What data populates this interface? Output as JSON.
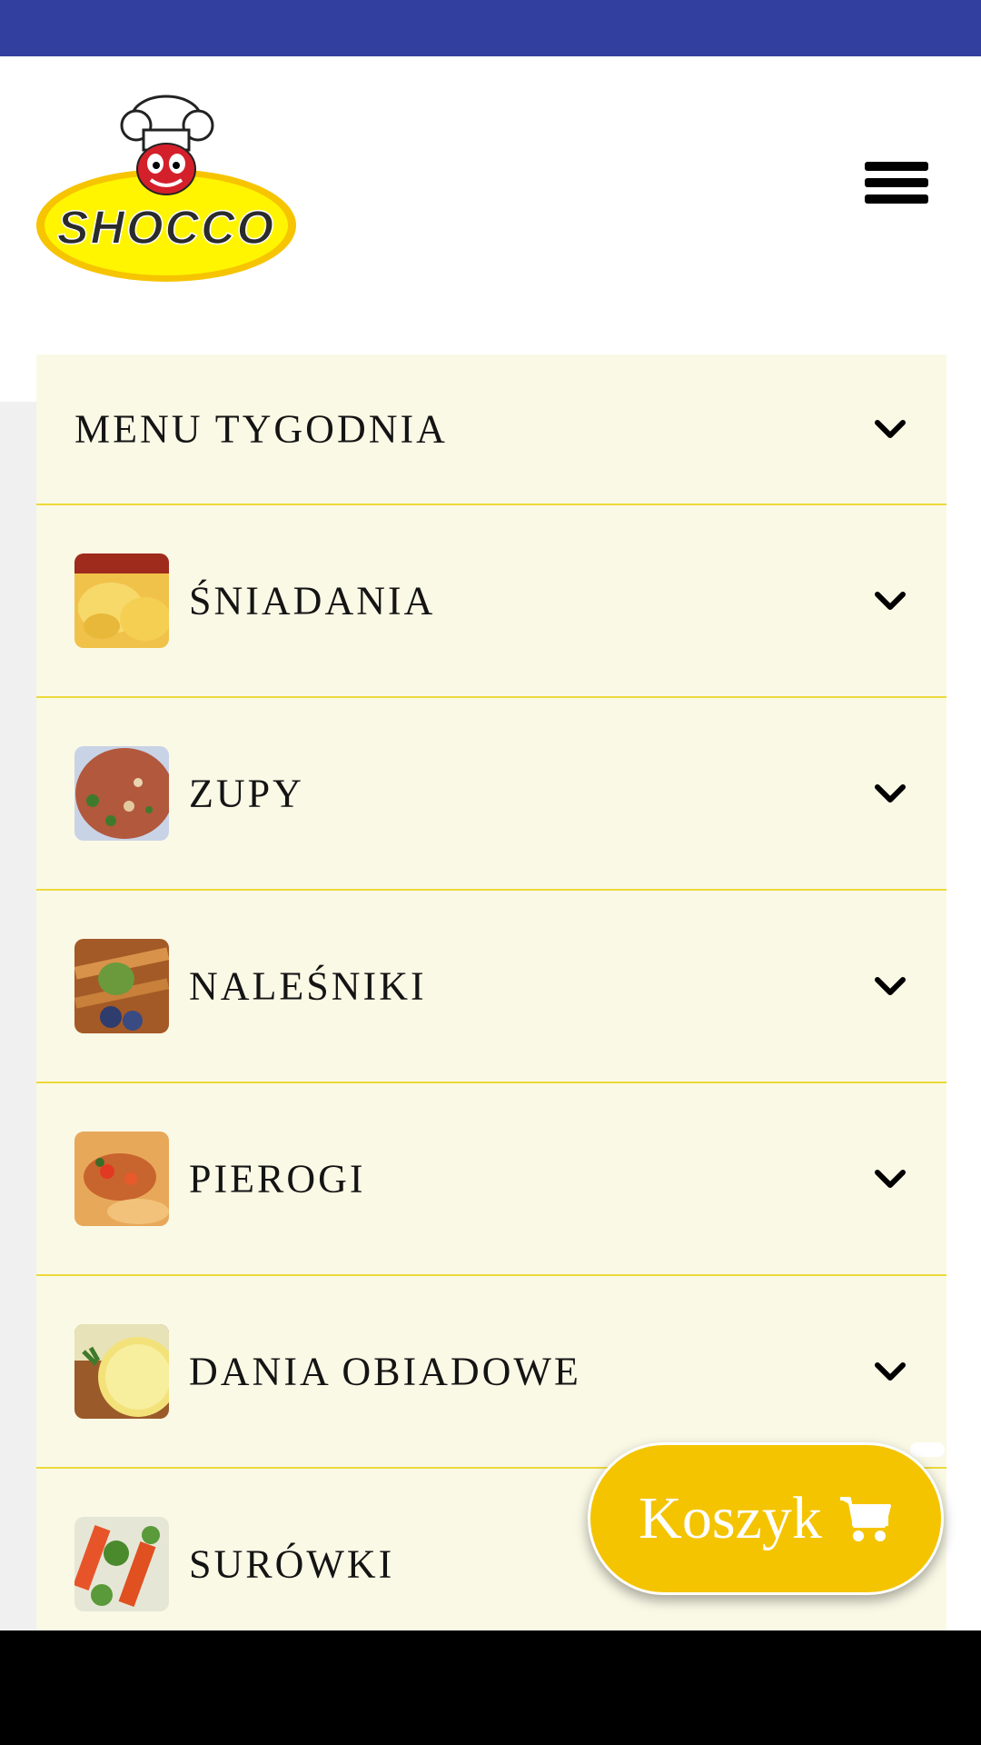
{
  "logo": {
    "text": "SHOCCO"
  },
  "menu": {
    "header_item": {
      "label": "MENU TYGODNIA"
    },
    "categories": [
      {
        "label": "ŚNIADANIA"
      },
      {
        "label": "ZUPY"
      },
      {
        "label": "NALEŚNIKI"
      },
      {
        "label": "PIEROGI"
      },
      {
        "label": "DANIA OBIADOWE"
      },
      {
        "label": "SURÓWKI"
      }
    ]
  },
  "cart": {
    "label": "Koszyk"
  },
  "colors": {
    "status_bar": "#333f9e",
    "accent": "#f4c400",
    "panel": "#faf9e6",
    "divider": "#ecd93a"
  }
}
